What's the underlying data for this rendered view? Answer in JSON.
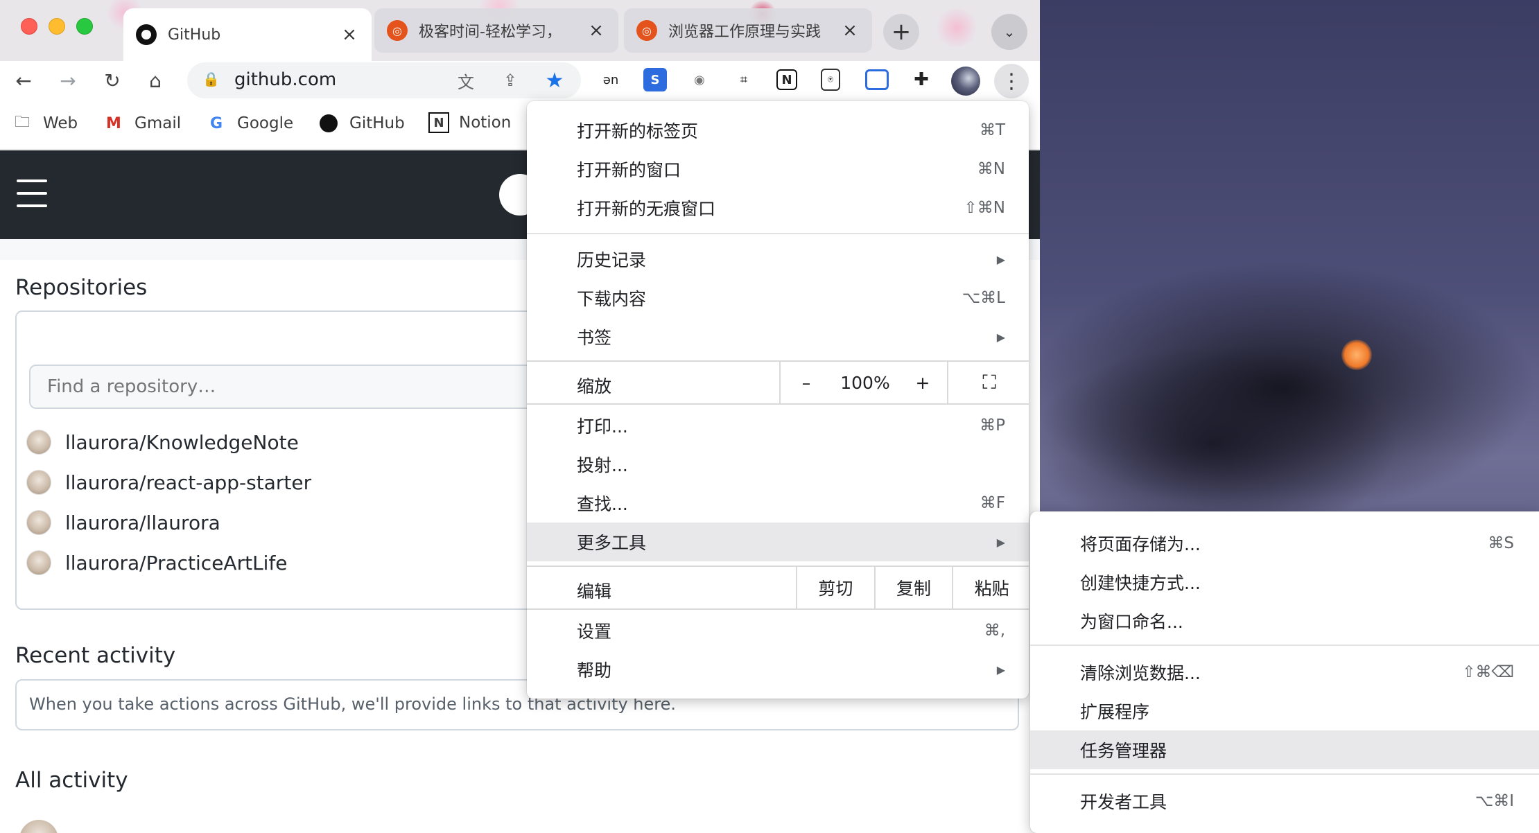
{
  "tabs": [
    {
      "title": "GitHub",
      "favicon": "github-icon",
      "active": true
    },
    {
      "title": "极客时间-轻松学习，",
      "favicon": "geekbang-icon",
      "active": false
    },
    {
      "title": "浏览器工作原理与实践",
      "favicon": "geekbang-icon",
      "active": false
    }
  ],
  "toolbar": {
    "url": "github.com"
  },
  "bookmarks": [
    {
      "label": "Web",
      "icon": "folder-icon"
    },
    {
      "label": "Gmail",
      "icon": "gmail-icon"
    },
    {
      "label": "Google",
      "icon": "google-icon"
    },
    {
      "label": "GitHub",
      "icon": "github-icon"
    },
    {
      "label": "Notion",
      "icon": "notion-icon"
    }
  ],
  "github": {
    "repositories_title": "Repositories",
    "find_placeholder": "Find a repository…",
    "repos": [
      "llaurora/KnowledgeNote",
      "llaurora/react-app-starter",
      "llaurora/llaurora",
      "llaurora/PracticeArtLife"
    ],
    "recent_activity_title": "Recent activity",
    "recent_activity_text": "When you take actions across GitHub, we'll provide links to that activity here.",
    "all_activity_title": "All activity"
  },
  "menu": {
    "new_tab": {
      "label": "打开新的标签页",
      "shortcut": "⌘T"
    },
    "new_window": {
      "label": "打开新的窗口",
      "shortcut": "⌘N"
    },
    "new_incognito": {
      "label": "打开新的无痕窗口",
      "shortcut": "⇧⌘N"
    },
    "history": {
      "label": "历史记录"
    },
    "downloads": {
      "label": "下载内容",
      "shortcut": "⌥⌘L"
    },
    "bookmarks": {
      "label": "书签"
    },
    "zoom": {
      "label": "缩放",
      "minus": "–",
      "value": "100%",
      "plus": "+"
    },
    "print": {
      "label": "打印...",
      "shortcut": "⌘P"
    },
    "cast": {
      "label": "投射..."
    },
    "find": {
      "label": "查找...",
      "shortcut": "⌘F"
    },
    "more_tools": {
      "label": "更多工具"
    },
    "edit": {
      "label": "编辑",
      "cut": "剪切",
      "copy": "复制",
      "paste": "粘贴"
    },
    "settings": {
      "label": "设置",
      "shortcut": "⌘,"
    },
    "help": {
      "label": "帮助"
    }
  },
  "submenu": {
    "save_page": {
      "label": "将页面存储为...",
      "shortcut": "⌘S"
    },
    "create_shortcut": {
      "label": "创建快捷方式..."
    },
    "name_window": {
      "label": "为窗口命名..."
    },
    "clear_data": {
      "label": "清除浏览数据...",
      "shortcut": "⇧⌘⌫"
    },
    "extensions": {
      "label": "扩展程序"
    },
    "task_manager": {
      "label": "任务管理器"
    },
    "dev_tools": {
      "label": "开发者工具",
      "shortcut": "⌥⌘I"
    }
  }
}
